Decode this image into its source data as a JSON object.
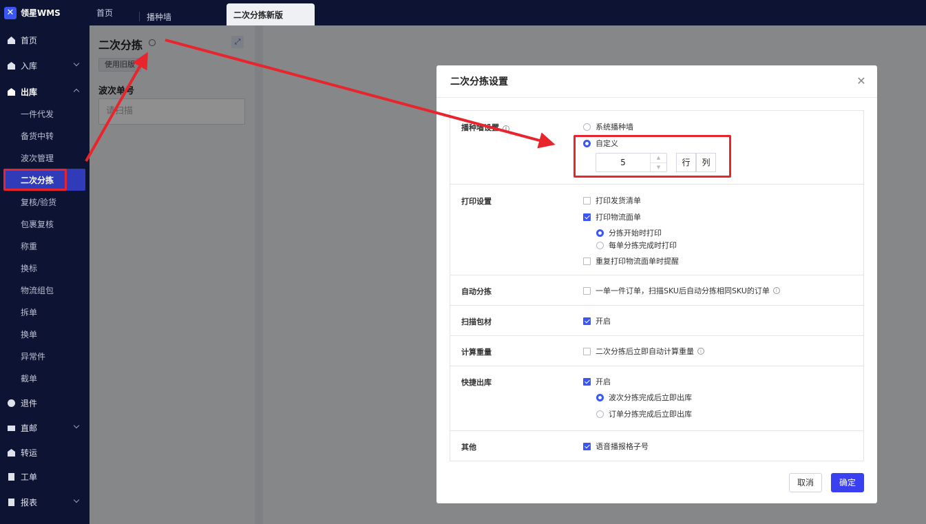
{
  "app": {
    "name": "领星WMS"
  },
  "tabs": [
    {
      "label": "首页"
    },
    {
      "label": "播种墙"
    },
    {
      "label": "二次分拣新版"
    }
  ],
  "sidebar": {
    "items": [
      {
        "label": "首页",
        "icon": "home-icon"
      },
      {
        "label": "入库",
        "icon": "inbound-icon"
      },
      {
        "label": "出库",
        "icon": "outbound-icon"
      },
      {
        "label": "退件",
        "icon": "return-icon"
      },
      {
        "label": "直邮",
        "icon": "direct-mail-icon"
      },
      {
        "label": "转运",
        "icon": "transfer-icon"
      },
      {
        "label": "工单",
        "icon": "workorder-icon"
      },
      {
        "label": "报表",
        "icon": "report-icon"
      }
    ],
    "outbound_sub": [
      "一件代发",
      "备货中转",
      "波次管理",
      "二次分拣",
      "复核/验货",
      "包裹复核",
      "称重",
      "换标",
      "物流组包",
      "拆单",
      "换单",
      "异常件",
      "截单"
    ]
  },
  "page": {
    "title": "二次分拣",
    "old_version_button": "使用旧版",
    "wave_label": "波次单号",
    "scan_placeholder": "请扫描"
  },
  "modal": {
    "title": "二次分拣设置",
    "rows": {
      "seeding": {
        "label": "播种墙设置",
        "options": [
          "系统播种墙",
          "自定义"
        ],
        "stepper_value": "5",
        "row_label": "行",
        "col_label": "列"
      },
      "print": {
        "label": "打印设置",
        "opt1": "打印发货清单",
        "opt2": "打印物流面单",
        "sub1": "分拣开始时打印",
        "sub2": "每单分拣完成时打印",
        "opt3": "重复打印物流面单时提醒"
      },
      "auto": {
        "label": "自动分拣",
        "opt": "一单一件订单，扫描SKU后自动分拣相同SKU的订单"
      },
      "scan_material": {
        "label": "扫描包材",
        "opt": "开启"
      },
      "weight": {
        "label": "计算重量",
        "opt": "二次分拣后立即自动计算重量"
      },
      "quick_out": {
        "label": "快捷出库",
        "opt": "开启",
        "sub1": "波次分拣完成后立即出库",
        "sub2": "订单分拣完成后立即出库"
      },
      "other": {
        "label": "其他",
        "opt": "语音播报格子号"
      }
    },
    "cancel": "取消",
    "confirm": "确定"
  },
  "colors": {
    "sidebar_bg": "#0d1433",
    "primary": "#3a3ff0",
    "annotation": "#e8242c"
  }
}
